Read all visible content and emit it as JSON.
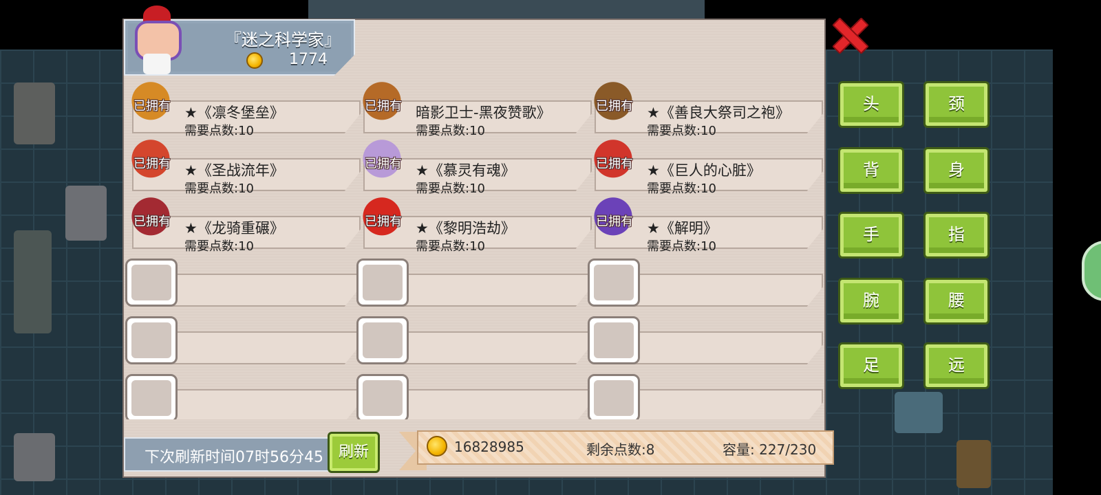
{
  "npc": {
    "title": "『迷之科学家』",
    "money": "1774"
  },
  "items": [
    {
      "owned_label": "已拥有",
      "name": "★《凛冬堡垒》",
      "cost": "需要点数:10",
      "icon": "winter-fortress-armor-icon",
      "color": "#d68a25"
    },
    {
      "owned_label": "已拥有",
      "name": "暗影卫士-黑夜赞歌》",
      "cost": "需要点数:10",
      "icon": "shadow-guard-armor-icon",
      "color": "#b56a27"
    },
    {
      "owned_label": "已拥有",
      "name": "★《善良大祭司之袍》",
      "cost": "需要点数:10",
      "icon": "priest-robe-armor-icon",
      "color": "#8a5a28"
    },
    {
      "owned_label": "已拥有",
      "name": "★《圣战流年》",
      "cost": "需要点数:10",
      "icon": "crusade-armor-icon",
      "color": "#d4462d"
    },
    {
      "owned_label": "已拥有",
      "name": "★《慕灵有魂》",
      "cost": "需要点数:10",
      "icon": "spirit-armor-icon",
      "color": "#b89ad8"
    },
    {
      "owned_label": "已拥有",
      "name": "★《巨人的心脏》",
      "cost": "需要点数:10",
      "icon": "giant-heart-armor-icon",
      "color": "#d1352b"
    },
    {
      "owned_label": "已拥有",
      "name": "★《龙骑重碾》",
      "cost": "需要点数:10",
      "icon": "dragon-knight-armor-icon",
      "color": "#a32a32"
    },
    {
      "owned_label": "已拥有",
      "name": "★《黎明浩劫》",
      "cost": "需要点数:10",
      "icon": "dawn-calamity-armor-icon",
      "color": "#d6281f"
    },
    {
      "owned_label": "已拥有",
      "name": "★《解明》",
      "cost": "需要点数:10",
      "icon": "jieming-cloak-icon",
      "color": "#6b42b8"
    }
  ],
  "empty_slot_count": 9,
  "refresh": {
    "timer_text": "下次刷新时间07时56分45",
    "button_label": "刷新"
  },
  "status": {
    "money": "16828985",
    "remaining_points": "剩余点数:8",
    "capacity": "容量:  227/230"
  },
  "categories": [
    "头",
    "颈",
    "背",
    "身",
    "手",
    "指",
    "腕",
    "腰",
    "足",
    "远"
  ],
  "colors": {
    "panel": "#ddd0c7",
    "header": "#8da0b2",
    "category_button": "#8fc43a",
    "close": "#e2262a"
  }
}
